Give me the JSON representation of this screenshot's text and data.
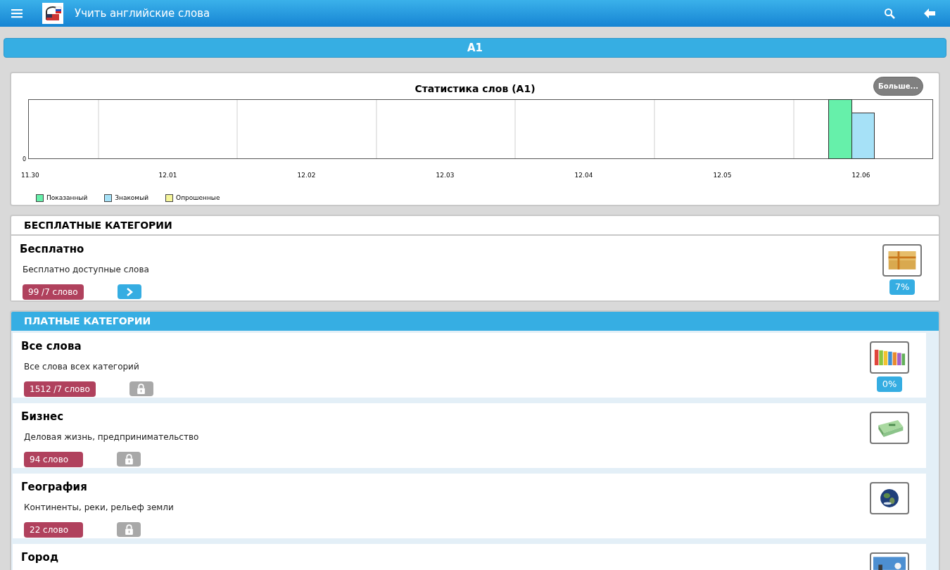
{
  "app_bar": {
    "title": "Учить английские слова"
  },
  "level_bar": {
    "label": "A1"
  },
  "chart": {
    "title": "Статистика слов (A1)",
    "more_button": "Больше...",
    "y_tick": "0",
    "x_labels": [
      "11.30",
      "12.01",
      "12.02",
      "12.03",
      "12.04",
      "12.05",
      "12.06"
    ],
    "legend": [
      {
        "label": "Показанный",
        "color": "#66f0aa"
      },
      {
        "label": "Знакомый",
        "color": "#a6e1f7"
      },
      {
        "label": "Опрошенные",
        "color": "#f5f59a"
      }
    ]
  },
  "free_section": {
    "title": "БЕСПЛАТНЫЕ КАТЕГОРИИ",
    "items": [
      {
        "title": "Бесплатно",
        "description": "Бесплатно доступные слова",
        "count": "99 /7 слово",
        "locked": false,
        "percent": "7%"
      }
    ]
  },
  "paid_section": {
    "title": "ПЛАТНЫЕ КАТЕГОРИИ",
    "items": [
      {
        "title": "Все слова",
        "description": "Все слова всех категорий",
        "count": "1512 /7 слово",
        "locked": true,
        "percent": "0%"
      },
      {
        "title": "Бизнес",
        "description": "Деловая жизнь, предпринимательство",
        "count": "94 слово",
        "locked": true
      },
      {
        "title": "География",
        "description": "Континенты, реки, рельеф земли",
        "count": "22 слово",
        "locked": true
      },
      {
        "title": "Город"
      }
    ]
  }
}
